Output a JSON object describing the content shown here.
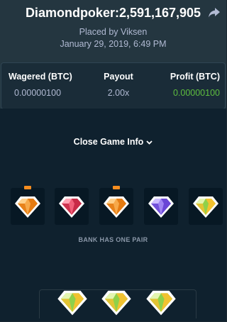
{
  "header": {
    "title": "Diamondpoker:2,591,167,905",
    "placed_by": "Placed by Viksen",
    "date": "January 29, 2019, 6:49 PM"
  },
  "stats": {
    "wagered_label": "Wagered (BTC)",
    "wagered_value": "0.00000100",
    "payout_label": "Payout",
    "payout_value": "2.00x",
    "profit_label": "Profit (BTC)",
    "profit_value": "0.00000100"
  },
  "game": {
    "close_info_label": "Close Game Info",
    "outcome_text": "BANK HAS ONE PAIR",
    "player_gems": [
      {
        "color": "orange",
        "highlighted": true
      },
      {
        "color": "red",
        "highlighted": false
      },
      {
        "color": "orange",
        "highlighted": true
      },
      {
        "color": "purple",
        "highlighted": false
      },
      {
        "color": "green",
        "highlighted": false
      }
    ],
    "bank_gems": [
      {
        "color": "green"
      },
      {
        "color": "green"
      },
      {
        "color": "green"
      }
    ]
  },
  "colors": {
    "profit": "#5ebd3e",
    "marker": "#f68d1f",
    "orange": "#f39c28",
    "red": "#e8506a",
    "purple": "#8b6ae8",
    "green": "#7bc43a",
    "yellow": "#f2c230"
  }
}
